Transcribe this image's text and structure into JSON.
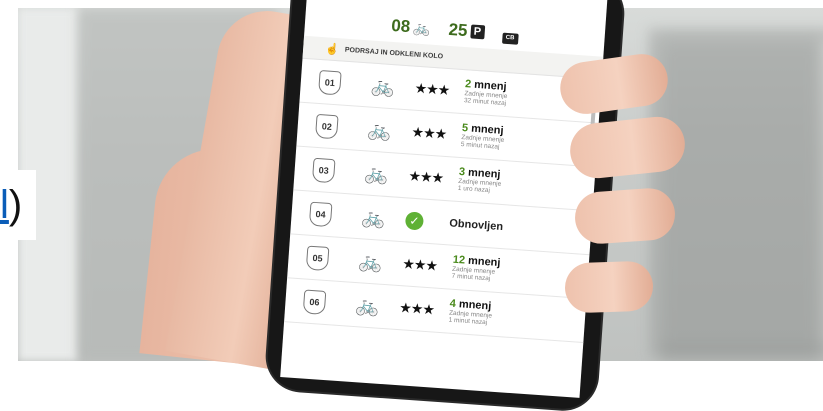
{
  "edge_text": {
    "link": "l",
    "paren": ")"
  },
  "stats": {
    "bikes": "08",
    "parking": "25",
    "parking_icon": "P",
    "card_icon": "CB"
  },
  "instruction": "PODRSAJ IN ODKLENI KOLO",
  "rows": [
    {
      "id": "01",
      "stars": "★★★",
      "count": "2",
      "unit": "mnenj",
      "sub1": "Zadnje mnenje",
      "sub2": "32 minut nazaj"
    },
    {
      "id": "02",
      "stars": "★★★",
      "count": "5",
      "unit": "mnenj",
      "sub1": "Zadnje mnenje",
      "sub2": "5 minut nazaj"
    },
    {
      "id": "03",
      "stars": "★★★",
      "count": "3",
      "unit": "mnenj",
      "sub1": "Zadnje mnenje",
      "sub2": "1 uro nazaj"
    },
    {
      "id": "04",
      "status": "Obnovljen"
    },
    {
      "id": "05",
      "stars": "★★★",
      "count": "12",
      "unit": "mnenj",
      "sub1": "Zadnje mnenje",
      "sub2": "7 minut nazaj"
    },
    {
      "id": "06",
      "stars": "★★★",
      "count": "4",
      "unit": "mnenj",
      "sub1": "Zadnje mnenje",
      "sub2": "1 minut nazaj"
    }
  ],
  "colors": {
    "accent_green": "#4a8a1c",
    "check_green": "#5fb135"
  }
}
